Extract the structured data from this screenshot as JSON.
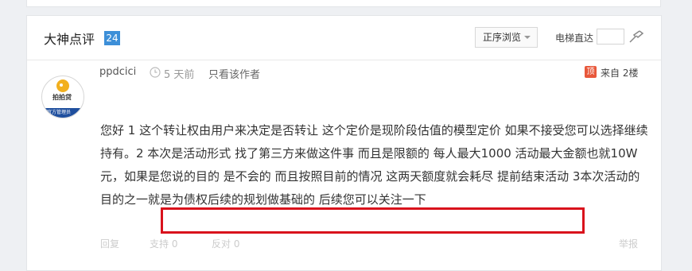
{
  "section": {
    "title": "大神点评",
    "count": "24"
  },
  "toolbar": {
    "sort_label": "正序浏览",
    "jump_label": "电梯直达",
    "jump_value": ""
  },
  "post": {
    "username": "ppdcici",
    "time": "5 天前",
    "author_only": "只看该作者",
    "source_icon": "顶",
    "floor": "来自 2楼",
    "avatar_title": "拍拍贷",
    "avatar_badge": "官方管理员",
    "body_normal": "您好 1 这个转让权由用户来决定是否转让 这个定价是现阶段估值的模型定价 如果不接受您可以选择继续持有。2 本次是活动形式 找了第三方来做这件事 而且是限额的 每人最大1000 活动最大金额也就10W元，如果是您说的目的 是不会的 而且按照目前的情况 这两天额度就会耗尽 提前结束活动 3",
    "body_highlight": "本次活动的目的之一就是为债权后续的规划做基础的 后续您可以关注一下",
    "highlight_color": "#d9121c"
  },
  "actions": {
    "reply": "回复",
    "upvote": "支持 0",
    "downvote": "反对 0",
    "report": "举报"
  }
}
